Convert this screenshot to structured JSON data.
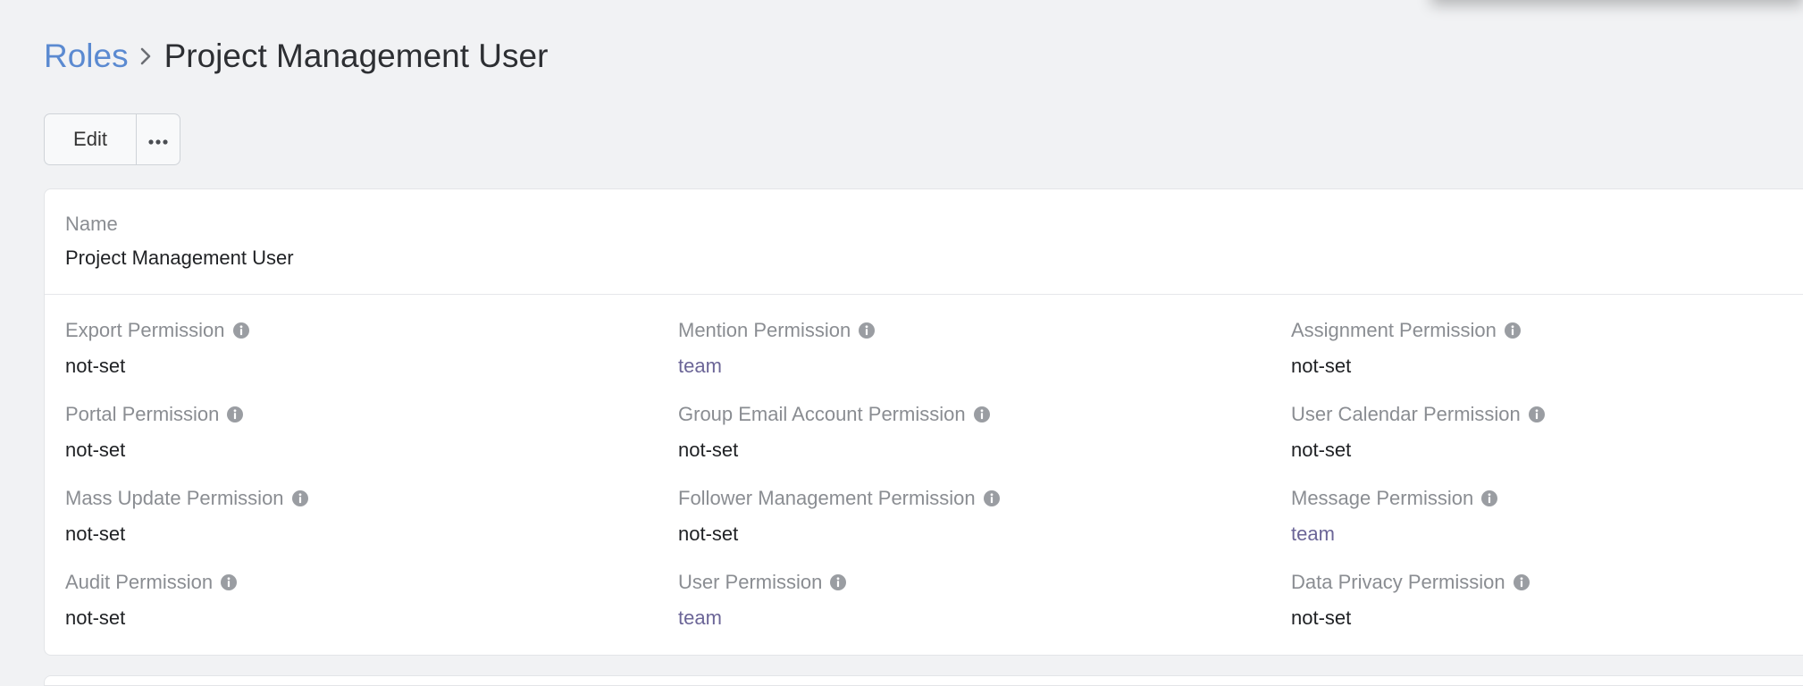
{
  "breadcrumb": {
    "parent": "Roles",
    "current": "Project Management User"
  },
  "toolbar": {
    "edit_label": "Edit",
    "more_icon": "ellipsis-icon"
  },
  "record": {
    "name_label": "Name",
    "name_value": "Project Management User",
    "fields": [
      {
        "label": "Export Permission",
        "value": "not-set"
      },
      {
        "label": "Mention Permission",
        "value": "team"
      },
      {
        "label": "Assignment Permission",
        "value": "not-set"
      },
      {
        "label": "Portal Permission",
        "value": "not-set"
      },
      {
        "label": "Group Email Account Permission",
        "value": "not-set"
      },
      {
        "label": "User Calendar Permission",
        "value": "not-set"
      },
      {
        "label": "Mass Update Permission",
        "value": "not-set"
      },
      {
        "label": "Follower Management Permission",
        "value": "not-set"
      },
      {
        "label": "Message Permission",
        "value": "team"
      },
      {
        "label": "Audit Permission",
        "value": "not-set"
      },
      {
        "label": "User Permission",
        "value": "team"
      },
      {
        "label": "Data Privacy Permission",
        "value": "not-set"
      }
    ]
  },
  "colors": {
    "link": "#5b8ad1",
    "team_value": "#6b6597",
    "label": "#8a8d92",
    "background": "#f1f2f4"
  }
}
